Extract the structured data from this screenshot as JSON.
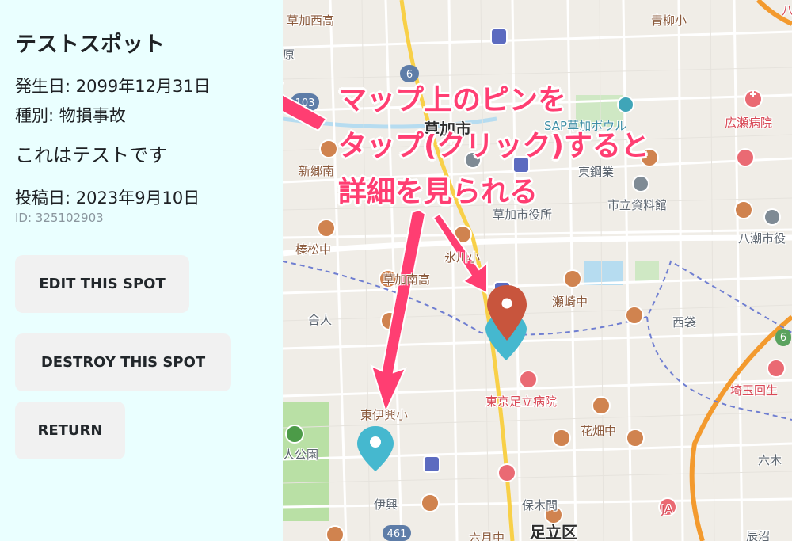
{
  "spot": {
    "name": "テストスポット",
    "occurred": "発生日: 2099年12月31日",
    "category": "種別: 物損事故",
    "description": "これはテストです",
    "posted": "投稿日: 2023年9月10日",
    "id": "ID: 325102903"
  },
  "buttons": {
    "edit": "EDIT THIS SPOT",
    "destroy": "DESTROY THIS SPOT",
    "return": "RETURN"
  },
  "annotation": {
    "line1": "マップ上のピンを",
    "line2": "タップ(クリック)すると",
    "line3": "詳細を見られる"
  },
  "map_labels": {
    "soka_nishi_high": "草加西高",
    "aoyagi_elem": "青柳小",
    "hara": "原",
    "soka_city": "草加市",
    "sap_bowl": "SAP草加ボウル",
    "hirose_hospital": "広瀬病院",
    "shingo_naka": "新郷南",
    "higashi_kogyo": "東鋼業",
    "soka_city_hall": "草加市役所",
    "shiritsu_shiryokan": "市立資料館",
    "hachijo_city": "八潮市役",
    "haramatsu_naka": "榛松中",
    "hikawa_elem": "氷川小",
    "soka_minami_high": "草加南高",
    "senzaki_naka": "瀬崎中",
    "toneri": "舎人",
    "nishibukuro": "西袋",
    "tokyo_adachi_hospital": "東京足立病院",
    "sakitama_hospital": "埼玉回生",
    "higashi_ikou_elem": "東伊興小",
    "hanahata_naka": "花畑中",
    "toneri_park": "人公園",
    "rokucho": "六木",
    "ikou": "伊興",
    "hokima": "保木間",
    "ja": "JA",
    "adachi_ku": "足立区",
    "rokugatsu": "六月中",
    "tatsunuma": "辰沼",
    "road_103": "103",
    "road_6": "6",
    "road_461": "461",
    "hachi": "八"
  },
  "colors": {
    "sidebar_bg": "#eaffff",
    "annotation": "#ff3e72",
    "pin_red": "#c8553d",
    "pin_teal": "#45b8cf"
  }
}
